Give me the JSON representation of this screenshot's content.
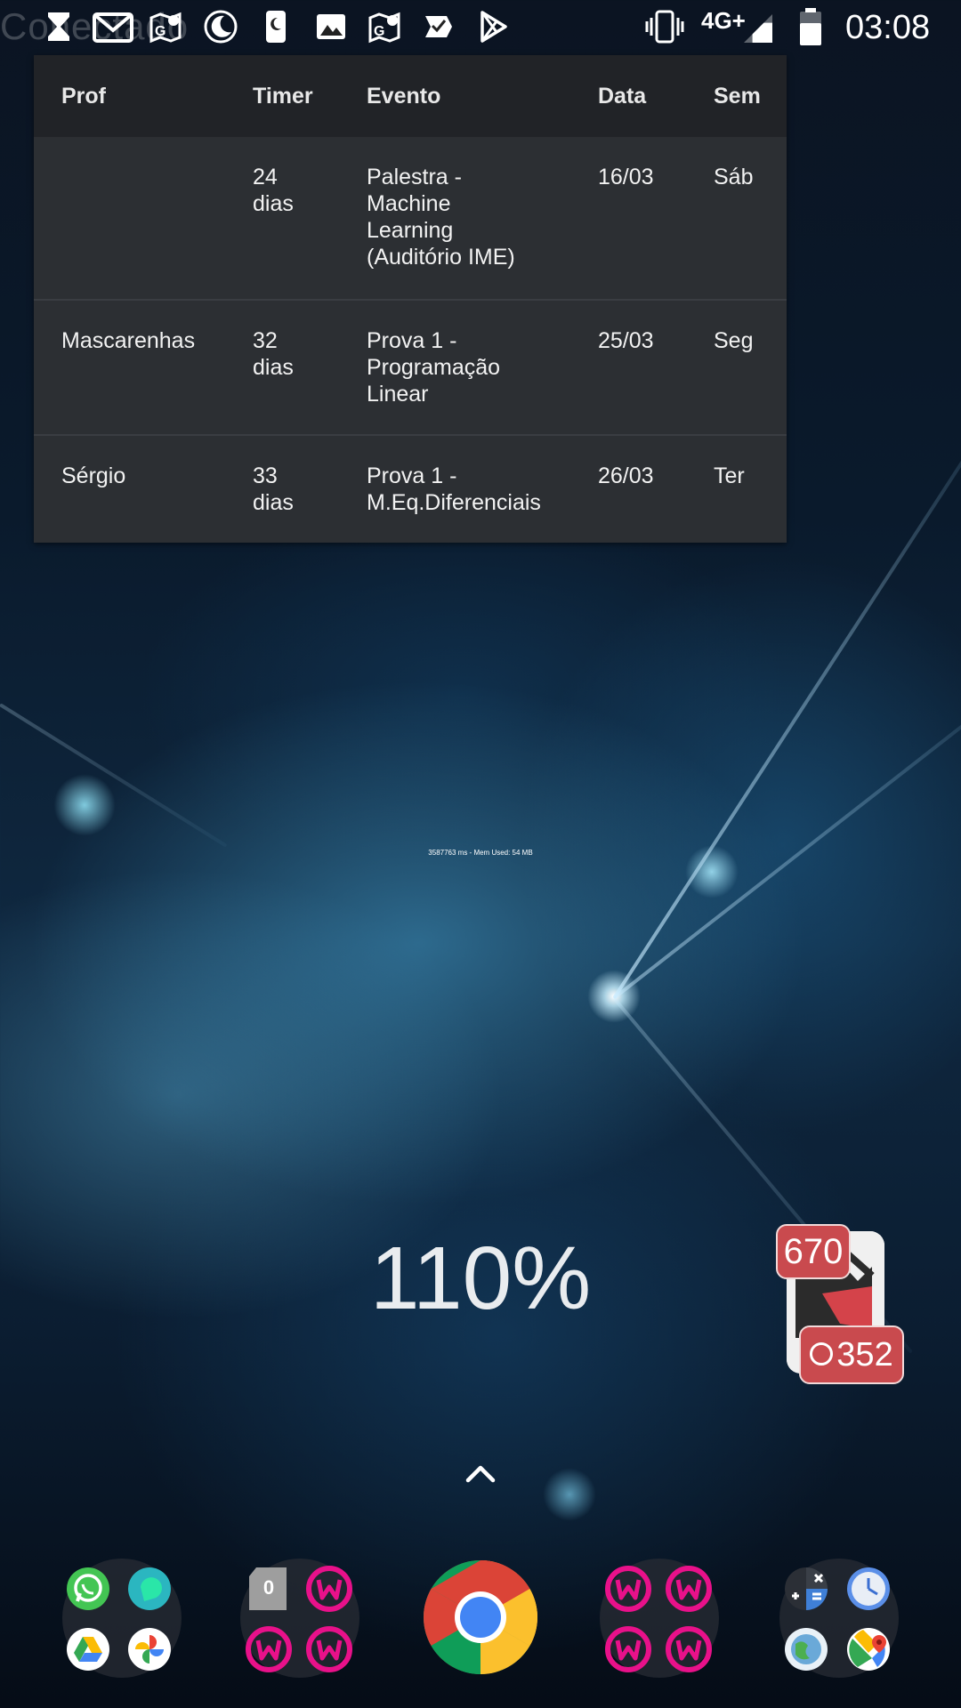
{
  "status_bar": {
    "ghost_title": "Conectado",
    "network": "4G+",
    "time": "03:08",
    "notification_icons": [
      "hourglass-icon",
      "gmail-icon",
      "maps-icon",
      "moon-icon",
      "phone-night-icon",
      "image-icon",
      "maps-icon",
      "task-check-icon",
      "play-store-icon"
    ],
    "system_icons": [
      "vibrate-icon",
      "signal-icon",
      "battery-icon"
    ]
  },
  "table": {
    "headers": [
      "Prof",
      "Timer",
      "Evento",
      "Data",
      "Sem"
    ],
    "rows": [
      {
        "prof": "",
        "timer": "24\ndias",
        "evento": "Palestra -\nMachine\nLearning\n(Auditório IME)",
        "data": "16/03",
        "sem": "Sáb"
      },
      {
        "prof": "Mascarenhas",
        "timer": "32\ndias",
        "evento": "Prova 1 -\nProgramação\nLinear",
        "data": "25/03",
        "sem": "Seg"
      },
      {
        "prof": "Sérgio",
        "timer": "33\ndias",
        "evento": "Prova 1 -\nM.Eq.Diferenciais",
        "data": "26/03",
        "sem": "Ter"
      }
    ]
  },
  "debug_text": "3587763 ms - Mem Used: 54 MB",
  "battery_percent": "110%",
  "counter_widget": {
    "top_count": "670",
    "bottom_count": "352",
    "accent": "#c94a4e"
  },
  "dock": {
    "folder_1": [
      "whatsapp-icon",
      "phone-app-icon",
      "google-drive-icon",
      "google-photos-icon"
    ],
    "folder_2": {
      "badge": "0",
      "apps": [
        "counter-app-icon",
        "pink-app-icon",
        "pink-app-icon",
        "pink-app-icon"
      ]
    },
    "center": "chrome-icon",
    "folder_3": [
      "pink-app-icon",
      "pink-app-icon",
      "pink-app-icon",
      "pink-app-icon"
    ],
    "folder_4": [
      "calculator-icon",
      "clock-icon",
      "earth-icon",
      "google-maps-icon"
    ]
  },
  "colors": {
    "table_bg": "#2c2f33",
    "table_header_bg": "#212327",
    "pink_app": "#e8118a"
  }
}
